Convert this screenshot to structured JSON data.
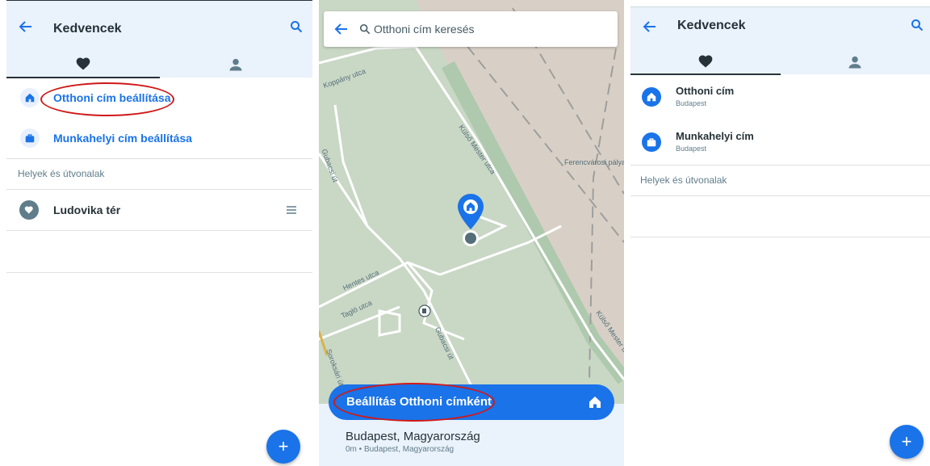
{
  "left_panel": {
    "header": {
      "title": "Kedvencek"
    },
    "home_link": "Otthoni cím beállítása",
    "work_link": "Munkahelyi cím beállítása",
    "section_label": "Helyek és útvonalak",
    "favorites": [
      {
        "label": "Ludovika tér"
      }
    ],
    "fab_label": "+"
  },
  "middle_panel": {
    "search": {
      "placeholder": "Otthoni cím keresés"
    },
    "map_labels": {
      "koppany": "Koppány utca",
      "kulso_mester_1": "Külső Mester utca",
      "kulso_mester_2": "Külső Mester utca",
      "ferencvarosi": "Ferencvárosi pálya",
      "hentes": "Hentes utca",
      "taglo": "Tagló utca",
      "gubacsi_1": "Gubacsi út",
      "gubacsi_2": "Gubacsi út",
      "soroksari": "Soroksári út"
    },
    "cta_label": "Beállítás Otthoni címként",
    "place": {
      "title": "Budapest, Magyarország",
      "subtitle": "0m • Budapest, Magyarország"
    }
  },
  "right_panel": {
    "header": {
      "title": "Kedvencek"
    },
    "home": {
      "title": "Otthoni cím",
      "subtitle": "Budapest"
    },
    "work": {
      "title": "Munkahelyi cím",
      "subtitle": "Budapest"
    },
    "section_label": "Helyek és útvonalak",
    "fab_label": "+"
  },
  "colors": {
    "accent": "#1a73e8",
    "header_bg": "#eaf2fb",
    "map_bg": "#c8d8c8",
    "annotation_red": "#d0191a"
  }
}
